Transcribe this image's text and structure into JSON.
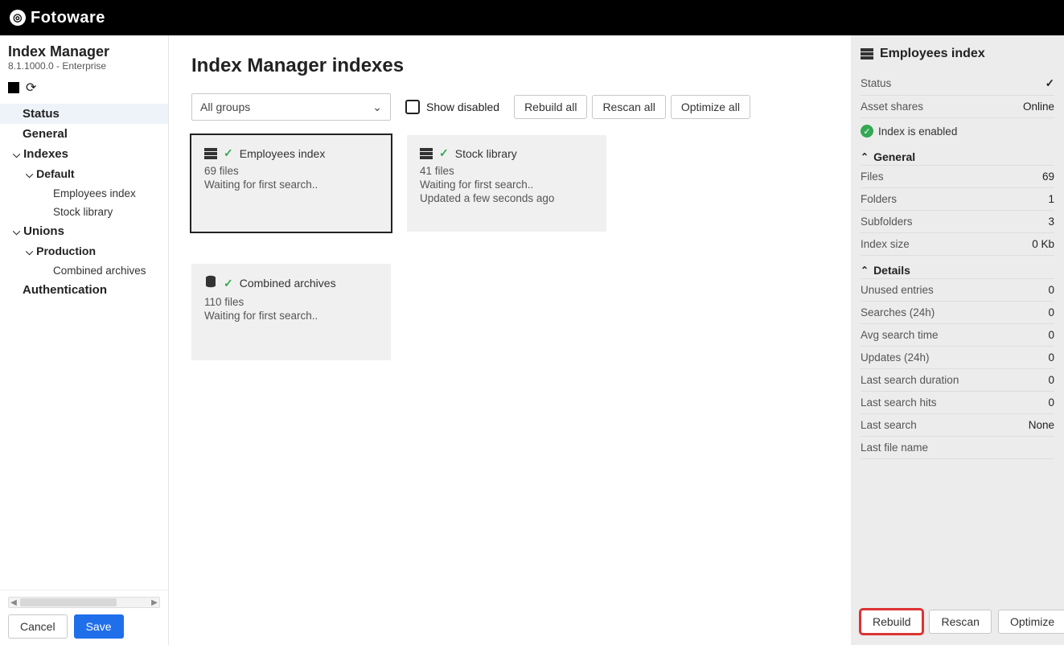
{
  "brand": "Fotoware",
  "sidebar": {
    "title": "Index Manager",
    "version": "8.1.1000.0 - Enterprise",
    "nav": {
      "status": "Status",
      "general": "General",
      "indexes": "Indexes",
      "default": "Default",
      "employees": "Employees index",
      "stock": "Stock library",
      "unions": "Unions",
      "production": "Production",
      "combined": "Combined archives",
      "auth": "Authentication"
    },
    "buttons": {
      "cancel": "Cancel",
      "save": "Save"
    }
  },
  "main": {
    "title": "Index Manager indexes",
    "group_selector": "All groups",
    "show_disabled": "Show disabled",
    "toolbar": {
      "rebuild_all": "Rebuild all",
      "rescan_all": "Rescan all",
      "optimize_all": "Optimize all"
    },
    "cards": [
      {
        "name": "Employees index",
        "files": "69 files",
        "line1": "Waiting for first search.."
      },
      {
        "name": "Stock library",
        "files": "41 files",
        "line1": "Waiting for first search..",
        "line2": "Updated a few seconds ago"
      },
      {
        "name": "Combined archives",
        "files": "110 files",
        "line1": "Waiting for first search..",
        "union": true
      }
    ]
  },
  "details": {
    "title": "Employees index",
    "status_label": "Status",
    "asset_shares_label": "Asset shares",
    "asset_shares": "Online",
    "enabled": "Index is enabled",
    "general_hdr": "General",
    "files_label": "Files",
    "files": "69",
    "folders_label": "Folders",
    "folders": "1",
    "subfolders_label": "Subfolders",
    "subfolders": "3",
    "size_label": "Index size",
    "size": "0 Kb",
    "details_hdr": "Details",
    "unused_label": "Unused entries",
    "unused": "0",
    "searches_label": "Searches (24h)",
    "searches": "0",
    "avg_label": "Avg search time",
    "avg": "0",
    "updates_label": "Updates (24h)",
    "updates": "0",
    "lastdur_label": "Last search duration",
    "lastdur": "0",
    "lasthits_label": "Last search hits",
    "lasthits": "0",
    "lastsearch_label": "Last search",
    "lastsearch": "None",
    "lastfile_label": "Last file name",
    "lastfile": "",
    "actions": {
      "rebuild": "Rebuild",
      "rescan": "Rescan",
      "optimize": "Optimize"
    }
  }
}
